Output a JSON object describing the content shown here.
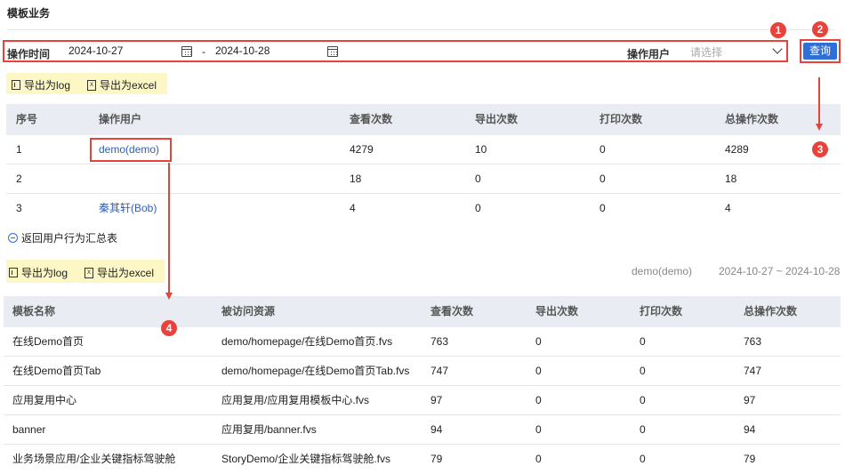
{
  "page_title": "模板业务",
  "filter": {
    "time_label": "操作时间",
    "date_start": "2024-10-27",
    "date_sep": "-",
    "date_end": "2024-10-28",
    "user_label": "操作用户",
    "user_placeholder": "请选择"
  },
  "query_button": "查询",
  "export": {
    "log_label": "导出为log",
    "excel_label": "导出为excel"
  },
  "table1": {
    "headers": [
      "序号",
      "操作用户",
      "查看次数",
      "导出次数",
      "打印次数",
      "总操作次数"
    ],
    "rows": [
      [
        "1",
        "demo(demo)",
        "4279",
        "10",
        "0",
        "4289"
      ],
      [
        "2",
        "",
        "18",
        "0",
        "0",
        "18"
      ],
      [
        "3",
        "秦其轩(Bob)",
        "4",
        "0",
        "0",
        "4"
      ]
    ]
  },
  "back_link": "返回用户行为汇总表",
  "detail_meta": {
    "user": "demo(demo)",
    "range": "2024-10-27 ~ 2024-10-28"
  },
  "table2": {
    "headers": [
      "模板名称",
      "被访问资源",
      "查看次数",
      "导出次数",
      "打印次数",
      "总操作次数"
    ],
    "rows": [
      [
        "在线Demo首页",
        "demo/homepage/在线Demo首页.fvs",
        "763",
        "0",
        "0",
        "763"
      ],
      [
        "在线Demo首页Tab",
        "demo/homepage/在线Demo首页Tab.fvs",
        "747",
        "0",
        "0",
        "747"
      ],
      [
        "应用复用中心",
        "应用复用/应用复用模板中心.fvs",
        "97",
        "0",
        "0",
        "97"
      ],
      [
        "banner",
        "应用复用/banner.fvs",
        "94",
        "0",
        "0",
        "94"
      ],
      [
        "业务场景应用/企业关键指标驾驶舱",
        "StoryDemo/企业关键指标驾驶舱.fvs",
        "79",
        "0",
        "0",
        "79"
      ]
    ]
  },
  "annotations": [
    "1",
    "2",
    "3",
    "4"
  ],
  "colors": {
    "accent": "#2f6fd8",
    "highlight": "#e8423b",
    "export_bg": "#fdf7c6",
    "header_bg": "#e9ecf2"
  }
}
